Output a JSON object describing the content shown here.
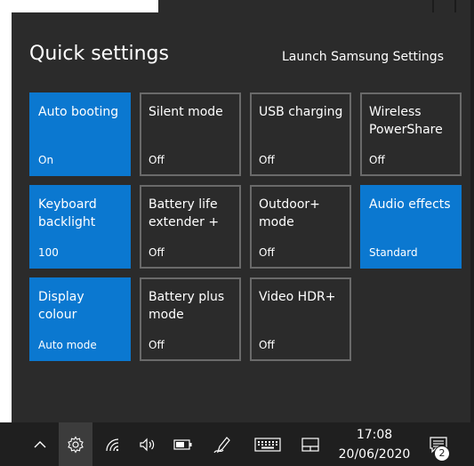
{
  "panel": {
    "title": "Quick settings",
    "launch_link": "Launch Samsung Settings"
  },
  "tiles": [
    {
      "label": "Auto booting",
      "status": "On",
      "active": true
    },
    {
      "label": "Silent mode",
      "status": "Off",
      "active": false
    },
    {
      "label": "USB charging",
      "status": "Off",
      "active": false
    },
    {
      "label": "Wireless\nPowerShare",
      "status": "Off",
      "active": false
    },
    {
      "label": "Keyboard\nbacklight",
      "status": "100",
      "active": true
    },
    {
      "label": "Battery life\nextender +",
      "status": "Off",
      "active": false
    },
    {
      "label": "Outdoor+\nmode",
      "status": "Off",
      "active": false
    },
    {
      "label": "Audio effects",
      "status": "Standard",
      "active": true
    },
    {
      "label": "Display colour",
      "status": "Auto mode",
      "active": true
    },
    {
      "label": "Battery plus\nmode",
      "status": "Off",
      "active": false
    },
    {
      "label": "Video HDR+",
      "status": "Off",
      "active": false
    }
  ],
  "taskbar": {
    "time": "17:08",
    "date": "20/06/2020",
    "notification_count": "2",
    "icons": [
      "chevron-up-icon",
      "gear-icon",
      "wifi-icon",
      "volume-icon",
      "battery-icon",
      "pen-icon",
      "keyboard-icon",
      "tablet-mode-icon",
      "notification-icon"
    ]
  },
  "colors": {
    "panel_bg": "#2b2b2b",
    "active_tile": "#0b78d0",
    "tile_border": "#6a6a6a",
    "taskbar_bg": "#1f1f1f"
  }
}
